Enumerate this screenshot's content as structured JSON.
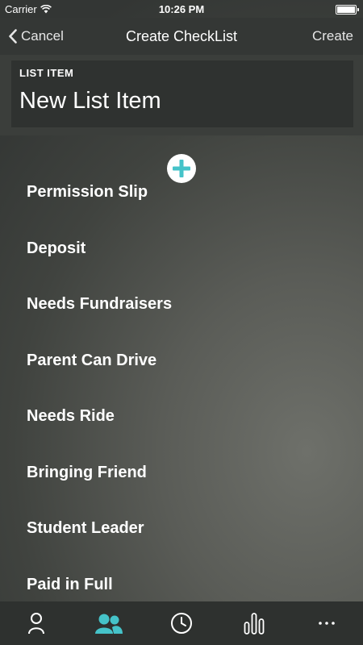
{
  "status_bar": {
    "carrier": "Carrier",
    "time": "10:26 PM",
    "icons": [
      "wifi-icon",
      "battery-icon"
    ]
  },
  "nav": {
    "cancel_label": "Cancel",
    "title": "Create CheckList",
    "create_label": "Create",
    "icons": [
      "chevron-left-icon"
    ]
  },
  "list_item": {
    "label": "LIST ITEM",
    "value": "New List Item"
  },
  "add_button": {
    "icon": "plus-icon",
    "color": "#45c3c9"
  },
  "checklist_items": [
    "Permission Slip",
    "Deposit",
    "Needs Fundraisers",
    "Parent Can Drive",
    "Needs Ride",
    "Bringing Friend",
    "Student Leader",
    "Paid in Full"
  ],
  "tab_bar": {
    "tabs": [
      {
        "icon": "person-icon",
        "active": false
      },
      {
        "icon": "group-icon",
        "active": true
      },
      {
        "icon": "clock-icon",
        "active": false
      },
      {
        "icon": "chart-icon",
        "active": false
      },
      {
        "icon": "more-icon",
        "active": false
      }
    ],
    "active_color": "#45c3c9",
    "inactive_color": "#ffffff"
  }
}
